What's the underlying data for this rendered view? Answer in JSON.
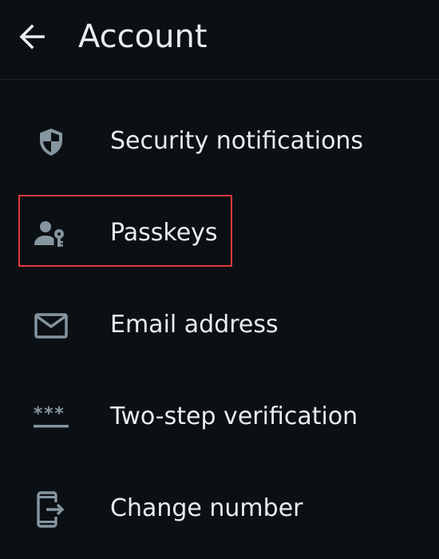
{
  "header": {
    "title": "Account",
    "back_icon": "arrow-left-icon"
  },
  "menu": {
    "items": [
      {
        "label": "Security notifications",
        "icon": "shield-icon"
      },
      {
        "label": "Passkeys",
        "icon": "person-key-icon"
      },
      {
        "label": "Email address",
        "icon": "envelope-icon"
      },
      {
        "label": "Two-step verification",
        "icon": "password-dots-icon"
      },
      {
        "label": "Change number",
        "icon": "phone-transfer-icon"
      }
    ]
  },
  "highlight": {
    "target": "Passkeys",
    "color": "#e03a3e"
  },
  "colors": {
    "background": "#0b1014",
    "text": "#e9edef",
    "icon": "#8696a0",
    "divider": "#1f262b"
  }
}
